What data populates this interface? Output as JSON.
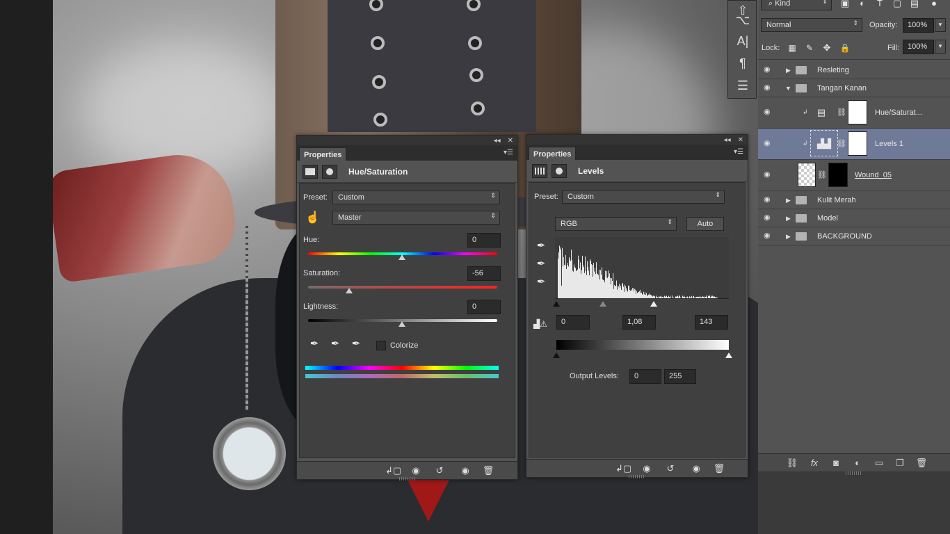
{
  "hue_sat_panel": {
    "tab": "Properties",
    "title": "Hue/Saturation",
    "preset_label": "Preset:",
    "preset_value": "Custom",
    "channel_value": "Master",
    "hue_label": "Hue:",
    "hue_value": "0",
    "saturation_label": "Saturation:",
    "saturation_value": "-56",
    "lightness_label": "Lightness:",
    "lightness_value": "0",
    "colorize_label": "Colorize"
  },
  "levels_panel": {
    "tab": "Properties",
    "title": "Levels",
    "preset_label": "Preset:",
    "preset_value": "Custom",
    "channel_value": "RGB",
    "auto_label": "Auto",
    "input_black": "0",
    "input_gamma": "1,08",
    "input_white": "143",
    "output_label": "Output Levels:",
    "output_black": "0",
    "output_white": "255"
  },
  "layers_panel": {
    "filter_label": "Kind",
    "blend_mode": "Normal",
    "opacity_label": "Opacity:",
    "opacity_value": "100%",
    "lock_label": "Lock:",
    "fill_label": "Fill:",
    "fill_value": "100%",
    "layers": [
      {
        "name": "Resleting"
      },
      {
        "name": "Tangan Kanan"
      },
      {
        "name": "Hue/Saturat..."
      },
      {
        "name": "Levels 1"
      },
      {
        "name": "Wound_05"
      },
      {
        "name": "Kulit Merah"
      },
      {
        "name": "Model"
      },
      {
        "name": "BACKGROUND"
      }
    ]
  },
  "colors": {
    "accent": "#6f7a99",
    "panel": "#535353",
    "panel_dark": "#404040"
  }
}
